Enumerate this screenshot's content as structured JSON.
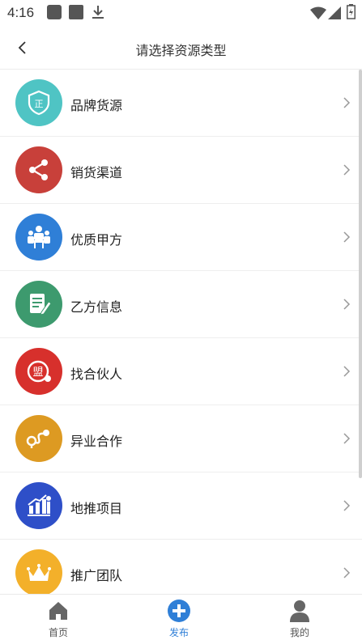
{
  "status_bar": {
    "time": "4:16"
  },
  "header": {
    "title": "请选择资源类型",
    "back_icon": "back-arrow-icon"
  },
  "items": [
    {
      "label": "品牌货源",
      "icon": "brand-shield-icon",
      "color": "#4fc4c4"
    },
    {
      "label": "销货渠道",
      "icon": "share-icon",
      "color": "#c8403a"
    },
    {
      "label": "优质甲方",
      "icon": "meeting-people-icon",
      "color": "#2f7fd7"
    },
    {
      "label": "乙方信息",
      "icon": "document-edit-icon",
      "color": "#3d9a6e"
    },
    {
      "label": "找合伙人",
      "icon": "alliance-badge-icon",
      "color": "#d7302c"
    },
    {
      "label": "异业合作",
      "icon": "route-pin-icon",
      "color": "#dd9a22"
    },
    {
      "label": "地推项目",
      "icon": "growth-bars-icon",
      "color": "#2e4fc8"
    },
    {
      "label": "推广团队",
      "icon": "crown-icon",
      "color": "#f3b02a"
    }
  ],
  "tabs": [
    {
      "label": "首页",
      "icon": "home-icon",
      "color": "#555555"
    },
    {
      "label": "发布",
      "icon": "plus-circle-icon",
      "color": "#2f7fd7"
    },
    {
      "label": "我的",
      "icon": "user-icon",
      "color": "#555555"
    }
  ]
}
